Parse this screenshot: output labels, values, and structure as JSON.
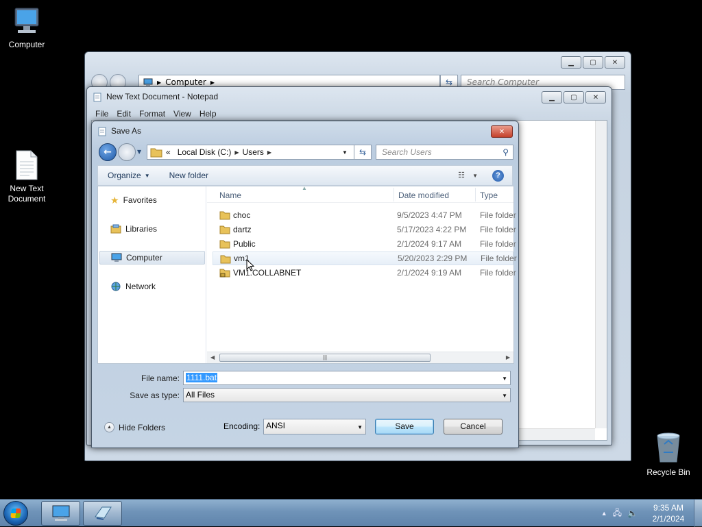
{
  "desktop": {
    "icons": [
      {
        "label": "Computer",
        "icon": "computer-icon"
      },
      {
        "label": "New Text Document",
        "icon": "text-document-icon"
      },
      {
        "label": "Recycle Bin",
        "icon": "recycle-bin-icon"
      }
    ]
  },
  "explorer": {
    "address_segment": "Computer",
    "search_placeholder": "Search Computer"
  },
  "notepad": {
    "title": "New Text Document - Notepad",
    "menu": [
      "File",
      "Edit",
      "Format",
      "View",
      "Help"
    ]
  },
  "save_dialog": {
    "title": "Save As",
    "address": {
      "overflow": "«",
      "segments": [
        "Local Disk (C:)",
        "Users"
      ]
    },
    "search_placeholder": "Search Users",
    "commands": {
      "organize": "Organize",
      "new_folder": "New folder"
    },
    "nav_pane": [
      {
        "label": "Favorites",
        "icon": "star-icon"
      },
      {
        "label": "Libraries",
        "icon": "library-icon"
      },
      {
        "label": "Computer",
        "icon": "computer-icon",
        "selected": true
      },
      {
        "label": "Network",
        "icon": "network-icon"
      }
    ],
    "columns": [
      "Name",
      "Date modified",
      "Type"
    ],
    "files": [
      {
        "name": "choc",
        "date": "9/5/2023 4:47 PM",
        "type": "File folder"
      },
      {
        "name": "dartz",
        "date": "5/17/2023 4:22 PM",
        "type": "File folder"
      },
      {
        "name": "Public",
        "date": "2/1/2024 9:17 AM",
        "type": "File folder"
      },
      {
        "name": "vm1",
        "date": "5/20/2023 2:29 PM",
        "type": "File folder",
        "hover": true
      },
      {
        "name": "VM1.COLLABNET",
        "date": "2/1/2024 9:19 AM",
        "type": "File folder",
        "locked": true
      }
    ],
    "file_name_label": "File name:",
    "file_name_value": "1111.bat",
    "save_type_label": "Save as type:",
    "save_type_value": "All Files",
    "hide_folders": "Hide Folders",
    "encoding_label": "Encoding:",
    "encoding_value": "ANSI",
    "save_button": "Save",
    "cancel_button": "Cancel"
  },
  "taskbar": {
    "time": "9:35 AM",
    "date": "2/1/2024"
  },
  "colors": {
    "selection": "#3399ff",
    "taskbar": "#6f93b8",
    "folder": "#e8c25a"
  }
}
